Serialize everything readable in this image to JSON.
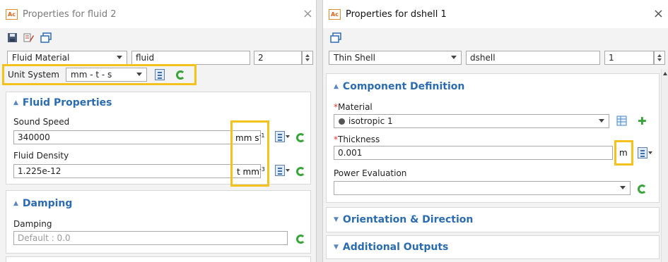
{
  "left": {
    "title": "Properties for fluid 2",
    "app_icon": "Ac",
    "close": "×",
    "toolbar_icons": [
      "save-icon",
      "edit-icon",
      "window-icon"
    ],
    "type_select": "Fluid Material",
    "name_value": "fluid",
    "id_value": "2",
    "unit_system_label": "Unit System",
    "unit_system_value": "mm - t - s",
    "fluid_properties": {
      "heading": "Fluid Properties",
      "sound_speed_label": "Sound Speed",
      "sound_speed_value": "340000",
      "sound_speed_unit": "mm s",
      "sound_speed_unit_exp": "-1",
      "density_label": "Fluid Density",
      "density_value": "1.225e-12",
      "density_unit": "t mm",
      "density_unit_exp": "-3"
    },
    "damping": {
      "heading": "Damping",
      "label": "Damping",
      "placeholder": "Default : 0.0"
    }
  },
  "right": {
    "title": "Properties for dshell 1",
    "app_icon": "Ac",
    "close": "×",
    "toolbar_icons": [
      "window-icon"
    ],
    "type_select": "Thin Shell",
    "name_value": "dshell",
    "id_value": "1",
    "component_definition": {
      "heading": "Component Definition",
      "material_label": "Material",
      "material_value": "isotropic 1",
      "thickness_label": "Thickness",
      "thickness_value": "0.001",
      "thickness_unit": "m",
      "power_label": "Power Evaluation"
    },
    "orientation_heading": "Orientation & Direction",
    "outputs_heading": "Additional Outputs"
  },
  "colors": {
    "highlight": "#f4c21c",
    "heading_blue": "#2b6cb0",
    "required_red": "#d33333",
    "icon_green": "#3aa33a"
  }
}
